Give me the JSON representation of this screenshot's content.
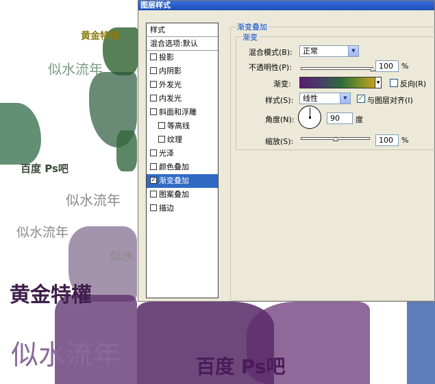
{
  "artwork": {
    "words": [
      {
        "text": "黄金特權",
        "color": "#8a7a10",
        "size": 14,
        "weight": "bold"
      },
      {
        "text": "似水流年",
        "color": "#7a9a80",
        "size": 20,
        "weight": "normal"
      },
      {
        "text": "百度 Ps吧",
        "color": "#3a4a3a",
        "size": 15,
        "weight": "bold"
      },
      {
        "text": "似水流年",
        "color": "#8a8a8a",
        "size": 20,
        "weight": "normal"
      },
      {
        "text": "似水流年",
        "color": "#8a8a8a",
        "size": 19,
        "weight": "normal"
      },
      {
        "text": "似水",
        "color": "#8a8a8a",
        "size": 18,
        "weight": "normal"
      },
      {
        "text": "黄金特權",
        "color": "#3e1e4a",
        "size": 30,
        "weight": "bold"
      },
      {
        "text": "似水流年",
        "color": "#8a6a9a",
        "size": 40,
        "weight": "normal"
      },
      {
        "text": "百度  Ps吧",
        "color": "#4a1a5a",
        "size": 28,
        "weight": "bold"
      }
    ]
  },
  "dialog": {
    "title": "图层样式",
    "style_list": [
      {
        "label": "样式",
        "kind": "header",
        "checked": null
      },
      {
        "label": "混合选项:默认",
        "kind": "header",
        "checked": null
      },
      {
        "label": "投影",
        "kind": "item",
        "checked": false
      },
      {
        "label": "内阴影",
        "kind": "item",
        "checked": false
      },
      {
        "label": "外发光",
        "kind": "item",
        "checked": false
      },
      {
        "label": "内发光",
        "kind": "item",
        "checked": false
      },
      {
        "label": "斜面和浮雕",
        "kind": "item",
        "checked": false
      },
      {
        "label": "等高线",
        "kind": "sub",
        "checked": false
      },
      {
        "label": "纹理",
        "kind": "sub",
        "checked": false
      },
      {
        "label": "光泽",
        "kind": "item",
        "checked": false
      },
      {
        "label": "颜色叠加",
        "kind": "item",
        "checked": false
      },
      {
        "label": "渐变叠加",
        "kind": "item",
        "checked": true,
        "selected": true
      },
      {
        "label": "图案叠加",
        "kind": "item",
        "checked": false
      },
      {
        "label": "描边",
        "kind": "item",
        "checked": false
      }
    ],
    "panel": {
      "section_title": "渐变叠加",
      "group_title": "渐变",
      "blend_mode_label": "混合模式(B):",
      "blend_mode_value": "正常",
      "opacity_label": "不透明性(P):",
      "opacity_value": "100",
      "opacity_unit": "%",
      "opacity_level": 1.0,
      "gradient_label": "渐变:",
      "reverse_label": "反向(R)",
      "reverse_checked": false,
      "style_label": "样式(S):",
      "style_value": "线性",
      "align_label": "与图层对齐(I)",
      "align_checked": true,
      "angle_label": "角度(N):",
      "angle_value": "90",
      "angle_unit": "度",
      "scale_label": "缩放(S):",
      "scale_value": "100",
      "scale_unit": "%",
      "scale_level": 0.5
    }
  }
}
